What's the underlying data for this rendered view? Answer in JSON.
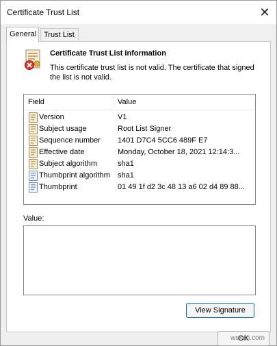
{
  "window": {
    "title": "Certificate Trust List",
    "close_glyph": "✕"
  },
  "tabs": [
    {
      "label": "General",
      "active": true
    },
    {
      "label": "Trust List",
      "active": false
    }
  ],
  "info": {
    "icon": "certificate-error-icon",
    "title": "Certificate Trust List Information",
    "description": "This certificate trust list is not valid.  The certificate that signed the list is not valid."
  },
  "grid": {
    "headers": {
      "field": "Field",
      "value": "Value"
    },
    "rows": [
      {
        "icon": "property-icon",
        "field": "Version",
        "value": "V1"
      },
      {
        "icon": "property-icon",
        "field": "Subject usage",
        "value": "Root List Signer"
      },
      {
        "icon": "property-icon",
        "field": "Sequence number",
        "value": "1401 D7C4 5CC6 489F E7"
      },
      {
        "icon": "property-icon",
        "field": "Effective date",
        "value": "Monday, October 18, 2021 12:14:3..."
      },
      {
        "icon": "property-icon",
        "field": "Subject algorithm",
        "value": "sha1"
      },
      {
        "icon": "extension-icon",
        "field": "Thumbprint algorithm",
        "value": "sha1"
      },
      {
        "icon": "extension-icon",
        "field": "Thumbprint",
        "value": "01 49 1f d2 3c 48 13 a6 02 d4 89 88..."
      }
    ]
  },
  "value_section": {
    "label": "Value:",
    "content": ""
  },
  "buttons": {
    "view_signature": "View Signature",
    "ok": "OK"
  },
  "watermark": "wsxdn.com",
  "colors": {
    "accent_border": "#0a64b8",
    "error_red": "#d9342b",
    "icon_tan": "#c8a46e"
  }
}
